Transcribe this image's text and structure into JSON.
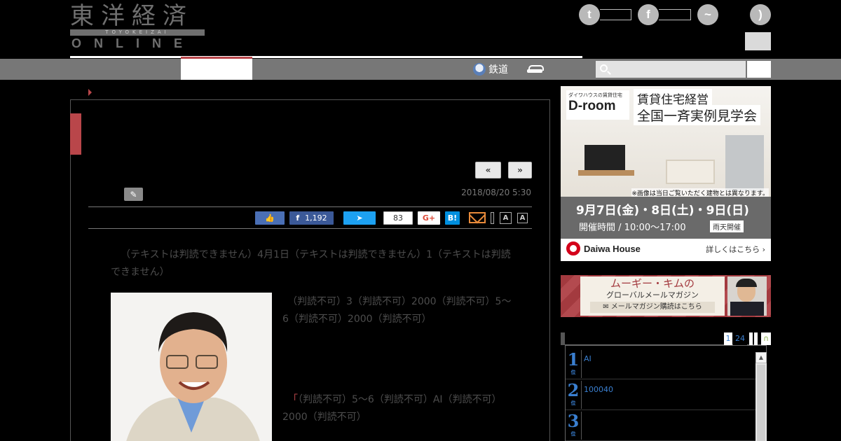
{
  "header": {
    "logo": {
      "kanji": "東洋経済",
      "sub": "TOYOKEIZAI",
      "en": "ONLINE"
    },
    "social": [
      {
        "name": "twitter-icon",
        "glyph": "t"
      },
      {
        "name": "facebook-icon",
        "glyph": "f"
      },
      {
        "name": "messenger-icon",
        "glyph": "~"
      },
      {
        "name": "rss-icon",
        "glyph": ")"
      }
    ],
    "nav": {
      "railway": "鉄道",
      "car": ""
    }
  },
  "article": {
    "pager_prev": "«",
    "pager_next": "»",
    "date": "2018/08/20 5:30",
    "share": {
      "like": "",
      "facebook_count": "1,192",
      "hatena_count": "83",
      "gplus": "G+",
      "hatena": "B!"
    },
    "text_size": [
      "A",
      "A"
    ],
    "lead": "（テキストは判読できません）4月1日（テキストは判読できません）1（テキストは判読できません）",
    "body_1": "（判読不可）3（判読不可）2000（判読不可）5〜6（判読不可）2000（判読不可）",
    "body_2_mark": "「",
    "body_2": "（判読不可）5〜6（判読不可）AI（判読不可）2000（判読不可）"
  },
  "ads": {
    "droom": {
      "brand_small": "ダイワハウスの賃貸住宅",
      "brand": "D-room",
      "headline_1": "賃貸住宅経営",
      "headline_2": "全国一斉実例見学会",
      "note": "※画像は当日ご覧いただく建物とは異なります。",
      "dates": "9月7日(金)・8日(土)・9日(日)",
      "time_label": "開催時間",
      "time": "10:00〜17:00",
      "rain": "雨天開催",
      "company": "Daiwa House",
      "cta": "詳しくはこちら"
    },
    "mugi": {
      "title": "ムーギー・キムの",
      "sub": "グローバルメールマガジン",
      "cta": "メールマガジン購読はこちら"
    }
  },
  "ranking": {
    "tabs": [
      "1",
      "24"
    ],
    "items": [
      {
        "rank": "1",
        "unit": "位",
        "text": "AI"
      },
      {
        "rank": "2",
        "unit": "位",
        "text": "100040"
      },
      {
        "rank": "3",
        "unit": "位",
        "text": ""
      }
    ]
  },
  "colors": {
    "accent": "#b9464a",
    "nav": "#777777",
    "link": "#3a7fd0"
  }
}
